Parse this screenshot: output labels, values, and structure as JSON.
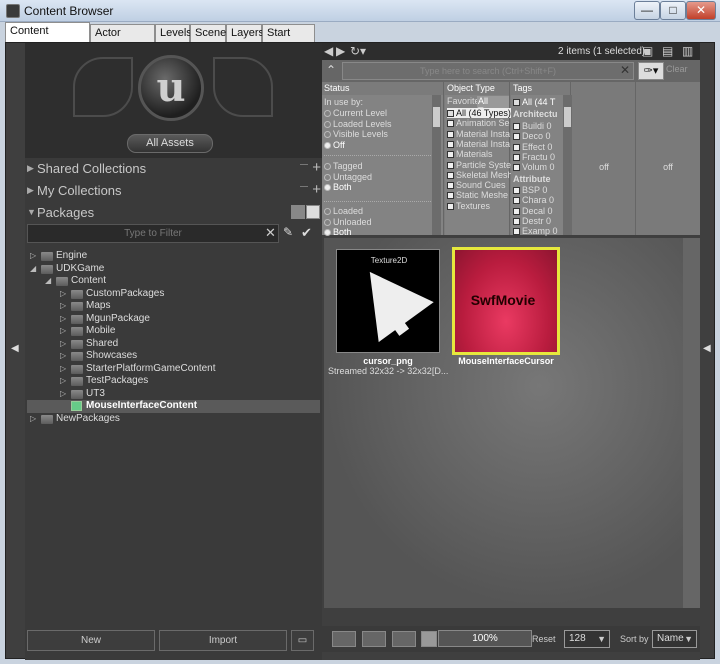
{
  "window": {
    "title": "Content Browser",
    "min": "—",
    "max": "□",
    "close": "✕"
  },
  "tabs": [
    "Content Browser",
    "Actor Classes",
    "Levels",
    "Scene",
    "Layers",
    "Start Page"
  ],
  "left": {
    "logo_letter": "u",
    "all_assets": "All Assets",
    "shared_collections": "Shared Collections",
    "my_collections": "My Collections",
    "packages": "Packages",
    "filter_placeholder": "Type to Filter",
    "tree": [
      {
        "label": "Engine",
        "depth": 0,
        "expanded": false,
        "kind": "folder"
      },
      {
        "label": "UDKGame",
        "depth": 0,
        "expanded": true,
        "kind": "folder"
      },
      {
        "label": "Content",
        "depth": 1,
        "expanded": true,
        "kind": "folder"
      },
      {
        "label": "CustomPackages",
        "depth": 2,
        "expanded": false,
        "kind": "folder"
      },
      {
        "label": "Maps",
        "depth": 2,
        "expanded": false,
        "kind": "folder"
      },
      {
        "label": "MgunPackage",
        "depth": 2,
        "expanded": false,
        "kind": "folder"
      },
      {
        "label": "Mobile",
        "depth": 2,
        "expanded": false,
        "kind": "folder"
      },
      {
        "label": "Shared",
        "depth": 2,
        "expanded": false,
        "kind": "folder"
      },
      {
        "label": "Showcases",
        "depth": 2,
        "expanded": false,
        "kind": "folder"
      },
      {
        "label": "StarterPlatformGameContent",
        "depth": 2,
        "expanded": false,
        "kind": "folder"
      },
      {
        "label": "TestPackages",
        "depth": 2,
        "expanded": false,
        "kind": "folder"
      },
      {
        "label": "UT3",
        "depth": 2,
        "expanded": false,
        "kind": "folder"
      },
      {
        "label": "MouseInterfaceContent",
        "depth": 2,
        "expanded": null,
        "kind": "package",
        "selected": true
      },
      {
        "label": "NewPackages",
        "depth": 0,
        "expanded": false,
        "kind": "folder"
      }
    ],
    "new_button": "New",
    "import_button": "Import"
  },
  "right": {
    "items_count": "2 items (1 selected)",
    "search_placeholder": "Type here to search (Ctrl+Shift+F)",
    "clear": "Clear",
    "status": {
      "header": "Status",
      "in_use_by": "In use by:",
      "group1": [
        {
          "label": "Current Level",
          "on": false
        },
        {
          "label": "Loaded Levels",
          "on": false
        },
        {
          "label": "Visible Levels",
          "on": false
        },
        {
          "label": "Off",
          "on": true
        }
      ],
      "group2": [
        {
          "label": "Tagged",
          "on": false
        },
        {
          "label": "Untagged",
          "on": false
        },
        {
          "label": "Both",
          "on": true
        }
      ],
      "group3": [
        {
          "label": "Loaded",
          "on": false
        },
        {
          "label": "Unloaded",
          "on": false
        },
        {
          "label": "Both",
          "on": true
        }
      ]
    },
    "object_type": {
      "header": "Object Type",
      "favorites": "Favorite",
      "all_types_tab": "All Type",
      "items": [
        {
          "label": "All (46 Types)",
          "on": true
        },
        {
          "label": "Animation Se",
          "on": false
        },
        {
          "label": "Material Insta",
          "on": false
        },
        {
          "label": "Material Insta",
          "on": false
        },
        {
          "label": "Materials",
          "on": false
        },
        {
          "label": "Particle Syste",
          "on": false
        },
        {
          "label": "Skeletal Mesh",
          "on": false
        },
        {
          "label": "Sound Cues",
          "on": false
        },
        {
          "label": "Static Meshe",
          "on": false
        },
        {
          "label": "Textures",
          "on": false
        }
      ]
    },
    "tags": {
      "header": "Tags",
      "all": "All (44 T",
      "architecture": "Architectu",
      "arch_items": [
        "Buildi 0",
        "Deco 0",
        "Effect 0",
        "Fractu 0",
        "Volum 0"
      ],
      "attribute": "Attribute",
      "attr_items": [
        "BSP 0",
        "Chara 0",
        "Decal 0",
        "Destr 0",
        "Examp 0"
      ]
    },
    "off1": "off",
    "off2": "off",
    "assets": [
      {
        "type": "Texture2D",
        "name": "cursor_png",
        "sub": "Streamed 32x32 -> 32x32[D..."
      },
      {
        "type": "",
        "name": "MouseInterfaceCursor",
        "sub": "",
        "thumb_label": "SwfMovie"
      }
    ],
    "zoom": "100%",
    "reset": "Reset",
    "thumb_size": "128",
    "sort_by": "Sort by",
    "sort_value": "Name"
  },
  "colors": {
    "selection_border": "#e6e83d",
    "swf_thumb": "#d02a50"
  }
}
